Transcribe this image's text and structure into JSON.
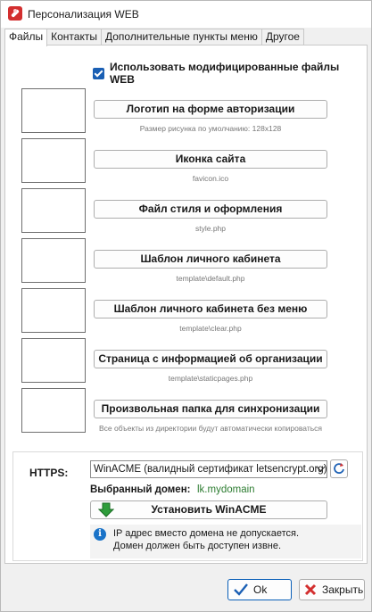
{
  "window": {
    "title": "Персонализация WEB"
  },
  "tabs": [
    "Файлы",
    "Контакты",
    "Дополнительные пункты меню",
    "Другое"
  ],
  "use_modified": {
    "label": "Использовать модифицированные файлы WEB",
    "checked": true
  },
  "files": [
    {
      "button": "Логотип на форме авторизации",
      "hint": "Размер рисунка по умолчанию: 128x128"
    },
    {
      "button": "Иконка сайта",
      "hint": "favicon.ico"
    },
    {
      "button": "Файл стиля и оформления",
      "hint": "style.php"
    },
    {
      "button": "Шаблон личного кабинета",
      "hint": "template\\default.php"
    },
    {
      "button": "Шаблон личного кабинета без меню",
      "hint": "template\\clear.php"
    },
    {
      "button": "Страница с информацией об организации",
      "hint": "template\\staticpages.php"
    },
    {
      "button": "Произвольная папка для синхронизации",
      "hint": "Все объекты из директории будут автоматически копироваться"
    }
  ],
  "https": {
    "label": "HTTPS:",
    "selected": "WinACME (валидный сертификат letsencrypt.org)",
    "domain_label": "Выбранный домен:",
    "domain_value": "lk.mydomain",
    "install_label": "Установить WinACME",
    "info_line1": "IP адрес вместо домена не допускается.",
    "info_line2": "Домен должен быть доступен извне."
  },
  "buttons": {
    "ok": "Ok",
    "close": "Закрыть"
  },
  "colors": {
    "accent": "#1a5fb4",
    "domain": "#2e7d32",
    "close_red": "#d32f2f",
    "ok_blue": "#0a5fb8"
  }
}
